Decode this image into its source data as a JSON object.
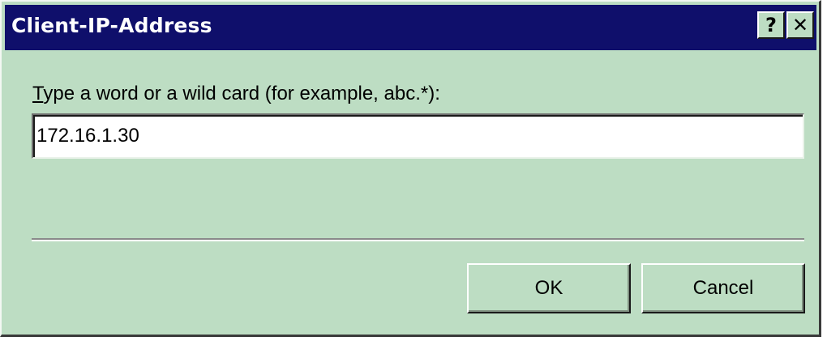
{
  "dialog": {
    "title": "Client-IP-Address",
    "help_glyph": "?",
    "close_glyph": "✕",
    "prompt": "Type a word or a wild card (for example, abc.*):",
    "prompt_mnemonic": "T",
    "value": "172.16.1.30",
    "ok_label": "OK",
    "cancel_label": "Cancel"
  },
  "colors": {
    "titlebar": "#0f0f6b",
    "face": "#bdddc3",
    "title_text": "#ffffff"
  },
  "icons": {
    "help": "help-icon",
    "close": "close-icon"
  }
}
